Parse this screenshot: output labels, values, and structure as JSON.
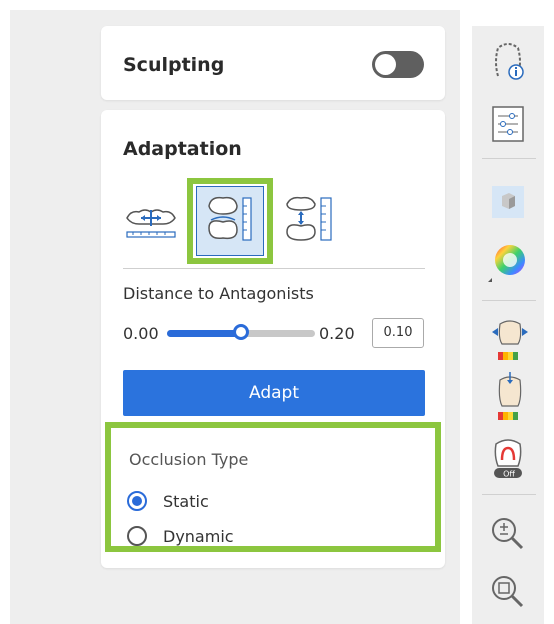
{
  "sculpting": {
    "title": "Sculpting",
    "toggle_on": false
  },
  "adaptation": {
    "title": "Adaptation",
    "modes": [
      {
        "icon": "adapt-horizontal-icon",
        "selected": false
      },
      {
        "icon": "adapt-tooth-distance-icon",
        "selected": true
      },
      {
        "icon": "adapt-vertical-icon",
        "selected": false
      }
    ],
    "distance_label": "Distance to Antagonists",
    "slider_min": "0.00",
    "slider_max": "0.20",
    "slider_value": "0.10",
    "slider_fraction": 0.5,
    "adapt_button": "Adapt",
    "occlusion": {
      "title": "Occlusion Type",
      "options": [
        {
          "label": "Static",
          "selected": true
        },
        {
          "label": "Dynamic",
          "selected": false
        }
      ]
    }
  },
  "toolbar": {
    "icons": [
      "jaw-info-icon",
      "sliders-settings-icon",
      "cube-view-icon",
      "color-wheel-icon",
      "tooth-spread-colormap-icon",
      "tooth-depth-colormap-icon",
      "tooth-off-icon",
      "zoom-in-out-icon",
      "zoom-fit-icon"
    ],
    "off_badge": "Off"
  },
  "colors": {
    "accent": "#2b73dd",
    "highlight": "#8cc63f",
    "toggle_off": "#5f5f5f"
  }
}
